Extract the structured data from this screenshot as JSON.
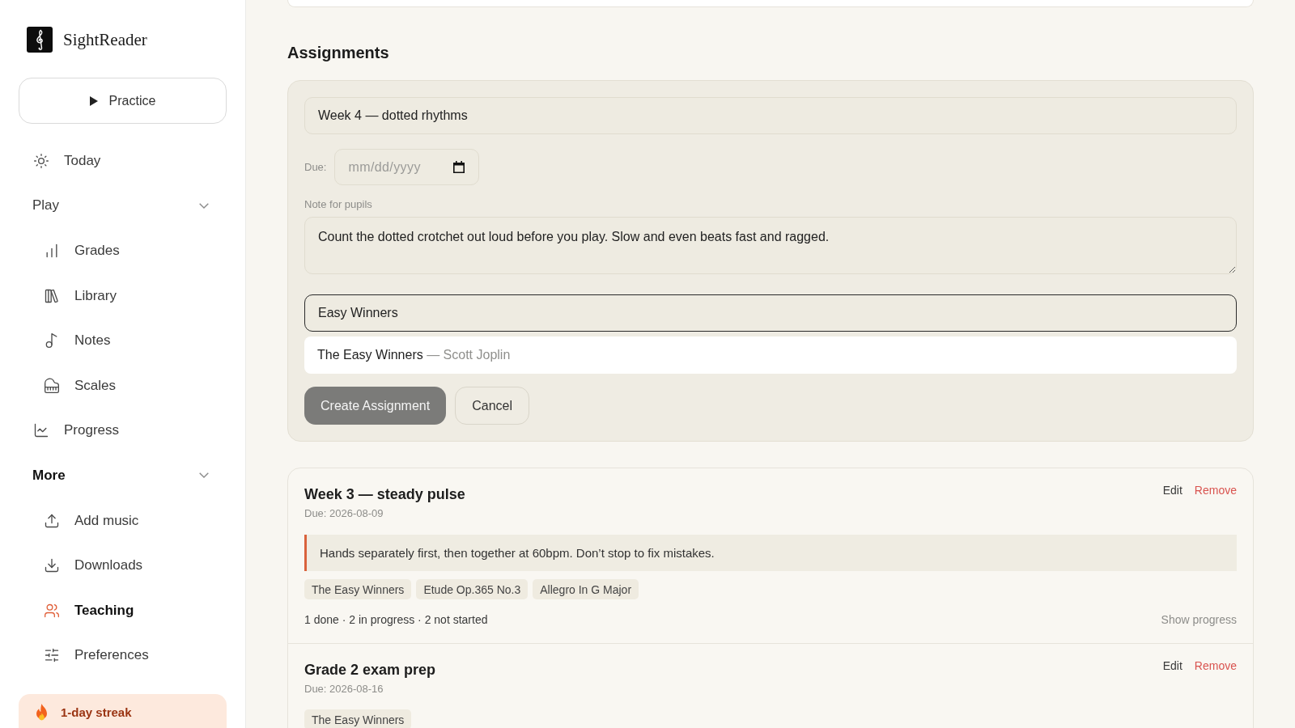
{
  "sidebar": {
    "brand": {
      "name": "SightReader"
    },
    "practice_button": {
      "label": "Practice"
    },
    "nav": [
      {
        "kind": "link",
        "label": "Today",
        "selected": false
      },
      {
        "kind": "group",
        "label": "Play",
        "expanded": true,
        "children": [
          {
            "label": "Grades",
            "selected": false
          },
          {
            "label": "Library",
            "selected": false
          },
          {
            "label": "Notes",
            "selected": false
          },
          {
            "label": "Scales",
            "selected": false
          }
        ]
      },
      {
        "kind": "link",
        "label": "Progress",
        "selected": false
      },
      {
        "kind": "group",
        "label": "More",
        "expanded": true,
        "children": [
          {
            "label": "Add music",
            "selected": false
          },
          {
            "label": "Downloads",
            "selected": false
          },
          {
            "label": "Teaching",
            "selected": true
          },
          {
            "label": "Preferences",
            "selected": false
          }
        ]
      }
    ],
    "streak": {
      "label": "1-day streak"
    }
  },
  "main": {
    "heading": "Assignments",
    "form": {
      "title_field": {
        "value": "Week 4 — dotted rhythms"
      },
      "due": {
        "label": "Due:",
        "placeholder": "mm/dd/yyyy"
      },
      "note": {
        "label": "Note for pupils",
        "value": "Count the dotted crotchet out loud before you play. Slow and even beats fast and ragged."
      },
      "piece_search": {
        "value": "Easy Winners",
        "focused": true
      },
      "suggestions": [
        {
          "title": "The Easy Winners",
          "composer": "— Scott Joplin"
        }
      ],
      "buttons": [
        {
          "kind": "primary",
          "label": "Create Assignment",
          "disabled": true
        },
        {
          "kind": "secondary",
          "label": "Cancel",
          "disabled": false
        }
      ]
    },
    "assignments": [
      {
        "title": "Week 3 — steady pulse",
        "due": "Due: 2026-08-09",
        "actions": [
          {
            "kind": "edit",
            "label": "Edit"
          },
          {
            "kind": "remove",
            "label": "Remove"
          }
        ],
        "note": "Hands separately first, then together at 60bpm. Don’t stop to fix mistakes.",
        "pieces": [
          "The Easy Winners",
          "Etude Op.365 No.3",
          "Allegro In G Major"
        ],
        "summary": "1 done · 2 in progress · 2 not started",
        "show_progress": "Show progress"
      },
      {
        "title": "Grade 2 exam prep",
        "due": "Due: 2026-08-16",
        "actions": [
          {
            "kind": "edit",
            "label": "Edit"
          },
          {
            "kind": "remove",
            "label": "Remove"
          }
        ],
        "pieces": [
          "The Easy Winners"
        ]
      }
    ]
  }
}
